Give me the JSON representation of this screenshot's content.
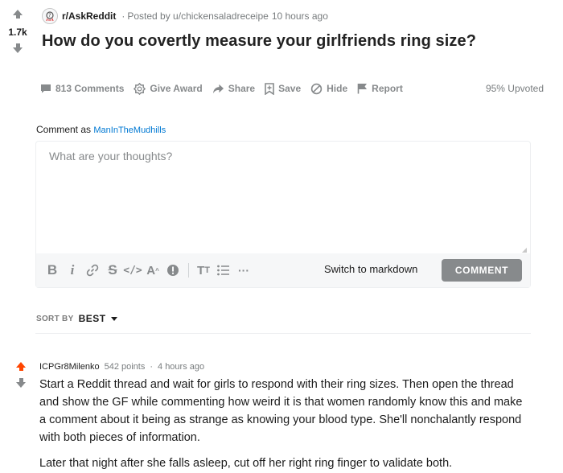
{
  "post": {
    "score": "1.7k",
    "subreddit": "r/AskReddit",
    "posted_by": "Posted by u/chickensaladreceipe",
    "time": "10 hours ago",
    "title": "How do you covertly measure your girlfriends ring size?",
    "upvoted": "95% Upvoted"
  },
  "actions": {
    "comments": "813 Comments",
    "award": "Give Award",
    "share": "Share",
    "save": "Save",
    "hide": "Hide",
    "report": "Report"
  },
  "composer": {
    "comment_as_label": "Comment as",
    "username": "ManInTheMudhills",
    "placeholder": "What are your thoughts?",
    "switch_markdown": "Switch to markdown",
    "submit": "COMMENT",
    "toolbar_icons": [
      "bold-icon",
      "italic-icon",
      "link-icon",
      "strikethrough-icon",
      "inline-code-icon",
      "superscript-icon",
      "spoiler-icon",
      "heading-icon",
      "bulleted-list-icon",
      "more-icon"
    ]
  },
  "sort": {
    "label": "SORT BY",
    "value": "BEST"
  },
  "comment": {
    "author": "ICPGr8Milenko",
    "points": "542 points",
    "time": "4 hours ago",
    "paragraphs": [
      "Start a Reddit thread and wait for girls to respond with their ring sizes. Then open the thread and show the GF while commenting how weird it is that women randomly know this and make a comment about it being as strange as knowing your blood type. She'll nonchalantly respond with both pieces of information.",
      "Later that night after she falls asleep, cut off her right ring finger to validate both."
    ]
  },
  "colors": {
    "upvote_active": "#ff4500",
    "muted": "#878a8c",
    "link_blue": "#0079d3"
  }
}
